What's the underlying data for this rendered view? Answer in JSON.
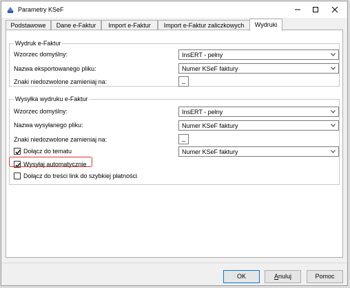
{
  "window": {
    "title": "Parametry KSeF"
  },
  "tabs": [
    {
      "label": "Podstawowe"
    },
    {
      "label": "Dane e-Faktur"
    },
    {
      "label": "Import e-Faktur"
    },
    {
      "label": "Import e-Faktur zaliczkowych"
    },
    {
      "label": "Wydruki"
    }
  ],
  "active_tab": "Wydruki",
  "group1": {
    "title": "Wydruk e-Faktur",
    "default_template_label": "Wzorzec domyślny:",
    "default_template_value": "InsERT - pełny",
    "export_file_label": "Nazwa eksportowanego pliku:",
    "export_file_value": "Numer KSeF faktury",
    "replace_chars_label": "Znaki niedozwolone zamieniaj na:",
    "replace_chars_value": "_"
  },
  "group2": {
    "title": "Wysyłka wydruku e-Faktur",
    "default_template_label": "Wzorzec domyślny:",
    "default_template_value": "InsERT - pełny",
    "sent_file_label": "Nazwa wysyłanego pliku:",
    "sent_file_value": "Numer KSeF faktury",
    "replace_chars_label": "Znaki niedozwolone zamieniaj na:",
    "replace_chars_value": "_",
    "attach_subject_label": "Dołącz do tematu",
    "attach_subject_checked": true,
    "attach_subject_value": "Numer KSeF faktury",
    "send_auto_label": "Wysyłaj automatycznie",
    "send_auto_checked": true,
    "quick_pay_label": "Dołącz do treści link do szybkiej płatności",
    "quick_pay_checked": false
  },
  "buttons": {
    "ok": "OK",
    "cancel_u": "A",
    "cancel_rest": "nuluj",
    "help": "Pomoc"
  },
  "colors": {
    "highlight": "#e0302b",
    "focus_border": "#0078d7"
  }
}
